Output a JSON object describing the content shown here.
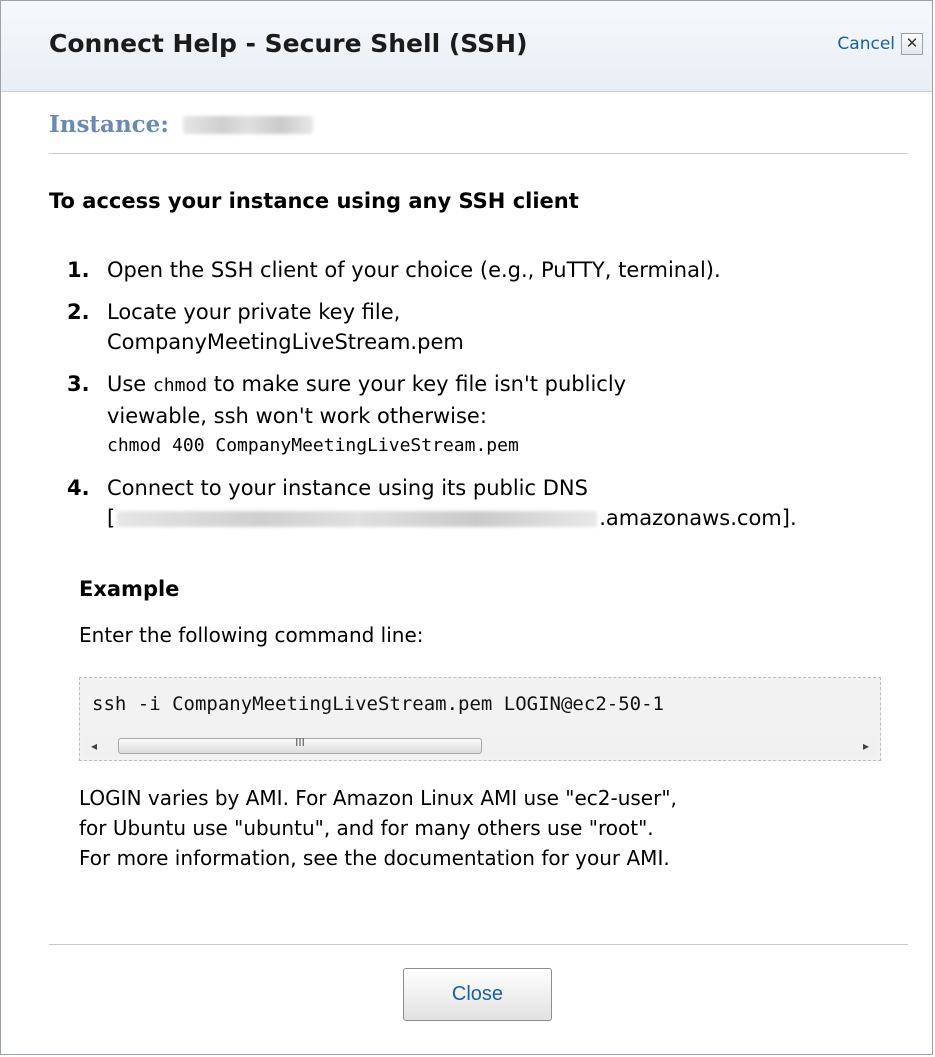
{
  "dialog": {
    "title": "Connect Help - Secure Shell (SSH)",
    "cancel_label": "Cancel",
    "cancel_icon": "close-x-icon"
  },
  "instance": {
    "label": "Instance:"
  },
  "heading": "To access your instance using any SSH client",
  "steps": [
    {
      "number": "1.",
      "text": "Open the SSH client of your choice (e.g., PuTTY, terminal)."
    },
    {
      "number": "2.",
      "line1": "Locate your private key file,",
      "line2": "CompanyMeetingLiveStream.pem"
    },
    {
      "number": "3.",
      "pre": "Use",
      "code": "chmod",
      "post": "to make sure your key file isn't publicly",
      "line2": "viewable, ssh won't work otherwise:",
      "command": "chmod 400 CompanyMeetingLiveStream.pem"
    },
    {
      "number": "4.",
      "line1": "Connect to your instance using its public DNS",
      "dns_open": "[",
      "dns_suffix": ".amazonaws.com]."
    }
  ],
  "example": {
    "title": "Example",
    "intro": "Enter the following command line:",
    "command": "ssh -i CompanyMeetingLiveStream.pem LOGIN@ec2-50-1",
    "scrollbar": {
      "left_arrow": "◂",
      "right_arrow": "▸",
      "grip": "III"
    }
  },
  "note": {
    "line1": "LOGIN varies by AMI. For Amazon Linux AMI use \"ec2-user\",",
    "line2": "for Ubuntu use \"ubuntu\", and for many others use \"root\".",
    "line3": "For more information, see the documentation for your AMI."
  },
  "footer": {
    "close_label": "Close"
  },
  "colors": {
    "title_bar": "#e8eef5",
    "instance_label": "#6a8ab3",
    "link": "#1b5fa8"
  }
}
